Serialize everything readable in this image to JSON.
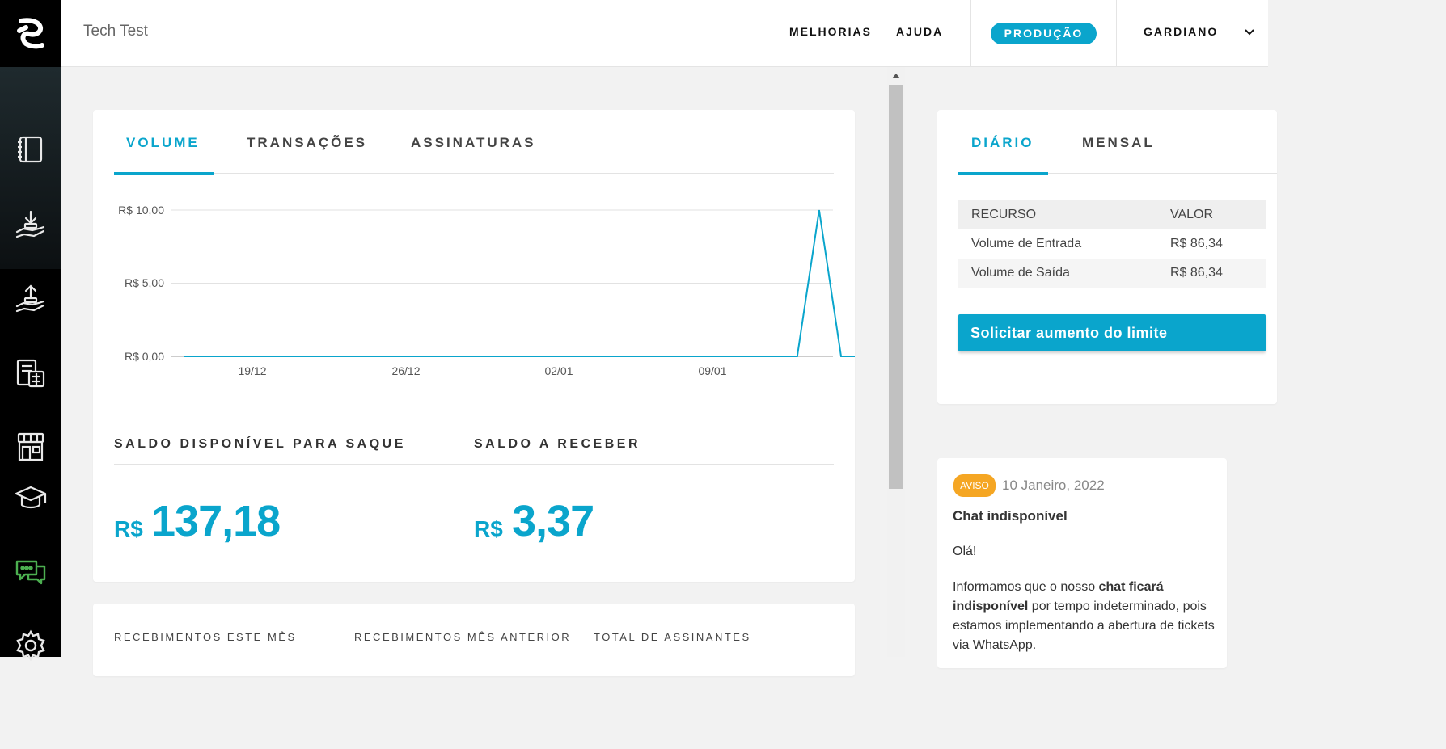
{
  "brand": {
    "logo_icon": "brand-logo-icon"
  },
  "sidebar": {
    "items": [
      {
        "icon": "ledger-icon"
      },
      {
        "icon": "receive-money-icon"
      },
      {
        "icon": "send-money-icon"
      },
      {
        "icon": "invoice-calculator-icon"
      },
      {
        "icon": "store-icon"
      },
      {
        "icon": "graduation-cap-icon"
      },
      {
        "icon": "chat-bubbles-icon"
      },
      {
        "icon": "gear-icon"
      }
    ]
  },
  "topbar": {
    "project_name": "Tech Test",
    "nav_improvements": "MELHORIAS",
    "nav_help": "AJUDA",
    "environment": "PRODUÇÃO",
    "user": "GARDIANO"
  },
  "main_card": {
    "tabs": [
      "VOLUME",
      "TRANSAÇÕES",
      "ASSINATURAS"
    ],
    "active_tab": "VOLUME",
    "balance_available_title": "SALDO DISPONÍVEL PARA SAQUE",
    "balance_available_currency": "R$",
    "balance_available_value": "137,18",
    "balance_receivable_title": "SALDO A RECEBER",
    "balance_receivable_currency": "R$",
    "balance_receivable_value": "3,37"
  },
  "chart_data": {
    "type": "line",
    "y_tick_labels": [
      "R$ 10,00",
      "R$ 5,00",
      "R$ 0,00"
    ],
    "y_ticks": [
      10,
      5,
      0
    ],
    "x_tick_labels": [
      "19/12",
      "26/12",
      "02/01",
      "09/01"
    ],
    "ylim": [
      0,
      10
    ],
    "grid": true,
    "series": [
      {
        "color": "#0aa5cc",
        "x": [
          "14/12",
          "15/12",
          "16/12",
          "17/12",
          "18/12",
          "19/12",
          "20/12",
          "21/12",
          "22/12",
          "23/12",
          "24/12",
          "25/12",
          "26/12",
          "27/12",
          "28/12",
          "29/12",
          "30/12",
          "31/12",
          "01/01",
          "02/01",
          "03/01",
          "04/01",
          "05/01",
          "06/01",
          "07/01",
          "08/01",
          "09/01",
          "10/01",
          "11/01",
          "12/01",
          "13/01",
          "14/01",
          "15/01"
        ],
        "values": [
          0,
          0,
          0,
          0,
          0,
          0,
          0,
          0,
          0,
          0,
          0,
          0,
          0,
          0,
          0,
          0,
          0,
          0,
          0,
          0,
          0,
          0,
          0,
          0,
          0,
          0,
          0,
          0,
          0,
          10,
          0,
          0,
          0
        ]
      }
    ]
  },
  "stats_card": {
    "received_this_month": "RECEBIMENTOS ESTE MÊS",
    "received_last_month": "RECEBIMENTOS MÊS ANTERIOR",
    "total_subscribers": "TOTAL DE ASSINANTES"
  },
  "limits_card": {
    "tabs": [
      "DIÁRIO",
      "MENSAL"
    ],
    "active_tab": "DIÁRIO",
    "col_resource": "RECURSO",
    "col_value": "VALOR",
    "rows": [
      {
        "resource": "Volume de Entrada",
        "value": "R$ 86,34"
      },
      {
        "resource": "Volume de Saída",
        "value": "R$ 86,34"
      }
    ],
    "request_button": "Solicitar aumento do limite"
  },
  "notice": {
    "badge": "AVISO",
    "date": "10 Janeiro, 2022",
    "title": "Chat indisponível",
    "greeting": "Olá!",
    "body_pre": "Informamos que o nosso ",
    "body_bold": "chat ficará indisponível",
    "body_post": " por tempo indeterminado, pois estamos implementando a abertura de tickets via WhatsApp."
  },
  "colors": {
    "accent": "#0aa5cc",
    "warning": "#f5a623",
    "sidebar": "#000000"
  }
}
